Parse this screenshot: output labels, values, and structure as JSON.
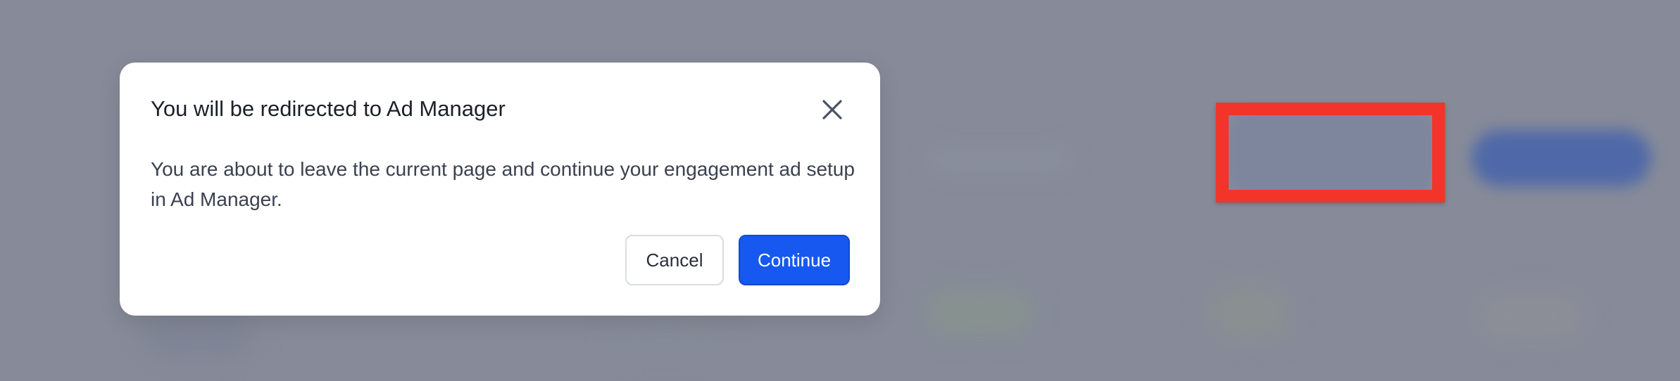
{
  "dialog": {
    "title": "You will be redirected to Ad Manager",
    "body": "You are about to leave the current page and continue your engagement ad setup in Ad Manager.",
    "close_icon": "close-icon",
    "cancel_label": "Cancel",
    "continue_label": "Continue"
  },
  "colors": {
    "overlay": "#878b99",
    "primary": "#1658f0",
    "highlight": "#f2342a",
    "dialog_background": "#ffffff"
  }
}
